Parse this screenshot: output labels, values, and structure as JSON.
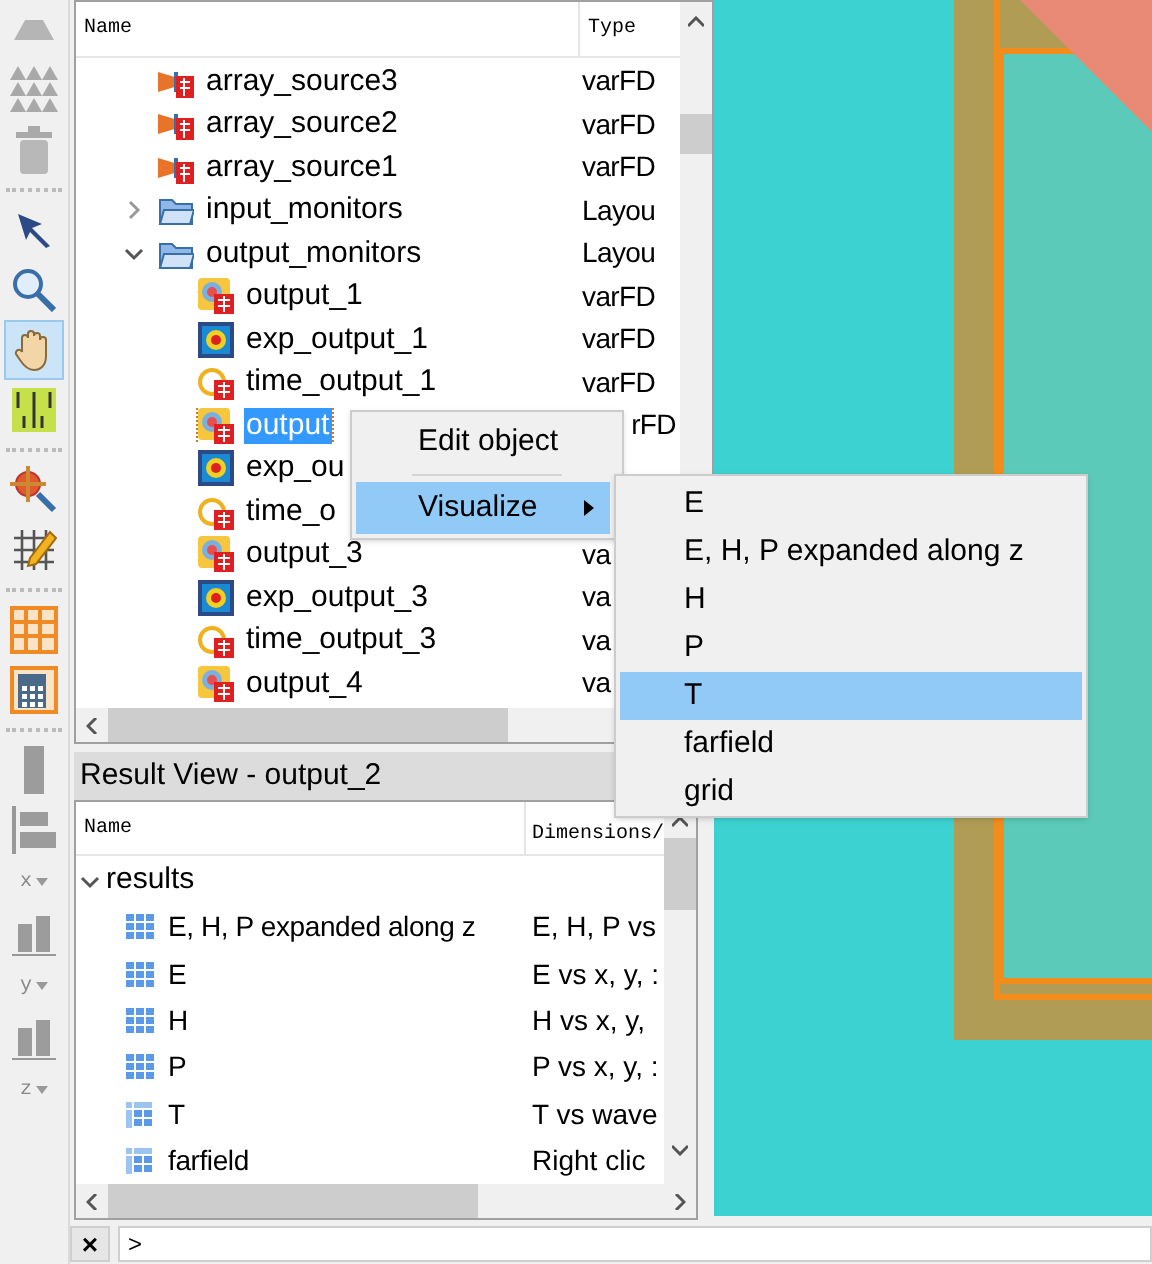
{
  "toolbar": {
    "tools": [
      {
        "kind": "pyramid",
        "selected": false
      },
      {
        "kind": "pyramids",
        "selected": false
      },
      {
        "kind": "trash",
        "selected": false
      },
      {
        "kind": "sep"
      },
      {
        "kind": "pointer",
        "selected": false
      },
      {
        "kind": "zoom",
        "selected": false
      },
      {
        "kind": "hand",
        "selected": true
      },
      {
        "kind": "ruler",
        "selected": false
      },
      {
        "kind": "sep"
      },
      {
        "kind": "zoom-move",
        "selected": false
      },
      {
        "kind": "grid-pencil",
        "selected": false
      },
      {
        "kind": "sep"
      },
      {
        "kind": "table",
        "selected": false
      },
      {
        "kind": "calculator",
        "selected": false
      },
      {
        "kind": "sep"
      },
      {
        "kind": "bar",
        "selected": false
      },
      {
        "kind": "align",
        "selected": false
      },
      {
        "kind": "axis",
        "label": "x"
      },
      {
        "kind": "chart",
        "selected": false
      },
      {
        "kind": "axis",
        "label": "y"
      },
      {
        "kind": "chart",
        "selected": false
      },
      {
        "kind": "axis",
        "label": "z"
      }
    ]
  },
  "object_tree": {
    "columns": [
      "Name",
      "Type"
    ],
    "rows": [
      {
        "name": "array_source3",
        "type": "varFD",
        "kind": "source",
        "selected": false
      },
      {
        "name": "array_source2",
        "type": "varFD",
        "kind": "source",
        "selected": false
      },
      {
        "name": "array_source1",
        "type": "varFD",
        "kind": "source",
        "selected": false
      },
      {
        "name": "input_monitors",
        "type": "Layou",
        "kind": "folder",
        "expanded": false,
        "selected": false,
        "children": []
      },
      {
        "name": "output_monitors",
        "type": "Layou",
        "kind": "folder",
        "expanded": true,
        "selected": false,
        "children": [
          {
            "name": "output_1",
            "type": "varFD",
            "kind": "monitor",
            "selected": false
          },
          {
            "name": "exp_output_1",
            "type": "varFD",
            "kind": "map",
            "selected": false
          },
          {
            "name": "time_output_1",
            "type": "varFD",
            "kind": "time",
            "selected": false
          },
          {
            "name": "output",
            "type": "rFD",
            "kind": "monitor",
            "selected": true
          },
          {
            "name": "exp_ou",
            "kind": "map",
            "selected": false
          },
          {
            "name": "time_o",
            "kind": "time",
            "selected": false
          },
          {
            "name": "output_3",
            "type": "va",
            "kind": "monitor",
            "selected": false
          },
          {
            "name": "exp_output_3",
            "type": "va",
            "kind": "map",
            "selected": false
          },
          {
            "name": "time_output_3",
            "type": "va",
            "kind": "time",
            "selected": false
          },
          {
            "name": "output_4",
            "type": "va",
            "kind": "monitor",
            "selected": false
          }
        ]
      }
    ]
  },
  "result_view": {
    "title": "Result View - output_2",
    "columns": [
      "Name",
      "Dimensions/"
    ],
    "group": {
      "name": "results",
      "expanded": true
    },
    "rows": [
      {
        "name": "E, H, P expanded along z",
        "dimensions": "E, H, P vs",
        "kind": "grid"
      },
      {
        "name": "E",
        "dimensions": "E vs x, y, :",
        "kind": "grid"
      },
      {
        "name": "H",
        "dimensions": "H vs x, y,",
        "kind": "grid"
      },
      {
        "name": "P",
        "dimensions": "P vs x, y, :",
        "kind": "grid"
      },
      {
        "name": "T",
        "dimensions": "T vs wave",
        "kind": "grid2"
      },
      {
        "name": "farfield",
        "dimensions": "Right clic",
        "kind": "grid2"
      }
    ]
  },
  "context_menu": {
    "items": [
      {
        "label": "Edit object",
        "kind": "item",
        "selected": false
      },
      {
        "kind": "separator"
      },
      {
        "label": "Visualize",
        "kind": "submenu",
        "selected": true
      }
    ],
    "submenu": [
      {
        "label": "E",
        "selected": false
      },
      {
        "label": "E, H, P expanded along z",
        "selected": false
      },
      {
        "label": "H",
        "selected": false
      },
      {
        "label": "P",
        "selected": false
      },
      {
        "label": "T",
        "selected": true
      },
      {
        "label": "farfield",
        "selected": false
      },
      {
        "label": "grid",
        "selected": false
      }
    ]
  },
  "command_line": {
    "close_label": "×",
    "prompt": ">"
  }
}
